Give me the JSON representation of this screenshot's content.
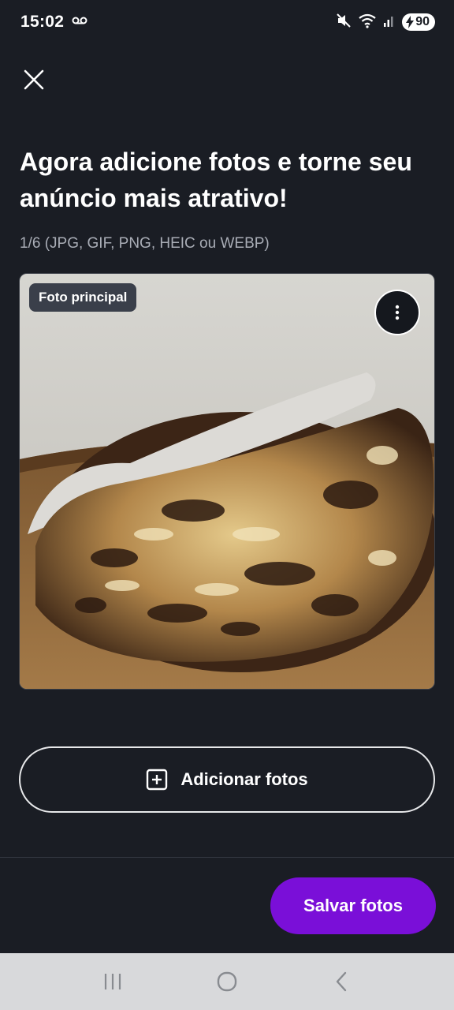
{
  "status_bar": {
    "time": "15:02",
    "battery": "90",
    "icons": [
      "voicemail-icon",
      "mute-icon",
      "wifi-icon",
      "signal-icon",
      "battery-charging-icon"
    ]
  },
  "header": {
    "close_icon": "close-icon",
    "title": "Agora adicione fotos e torne seu anúncio mais atrativo!",
    "subtitle": "1/6 (JPG, GIF, PNG, HEIC ou WEBP)"
  },
  "photo": {
    "badge": "Foto principal",
    "more_icon": "more-vertical-icon"
  },
  "actions": {
    "add_photos_label": "Adicionar fotos",
    "add_icon": "plus-square-icon",
    "save_label": "Salvar fotos"
  },
  "colors": {
    "background": "#1a1d24",
    "primary": "#7a0fd8",
    "muted_text": "#a9adb6"
  },
  "nav": {
    "icons": [
      "recents-icon",
      "home-icon",
      "back-icon"
    ]
  }
}
